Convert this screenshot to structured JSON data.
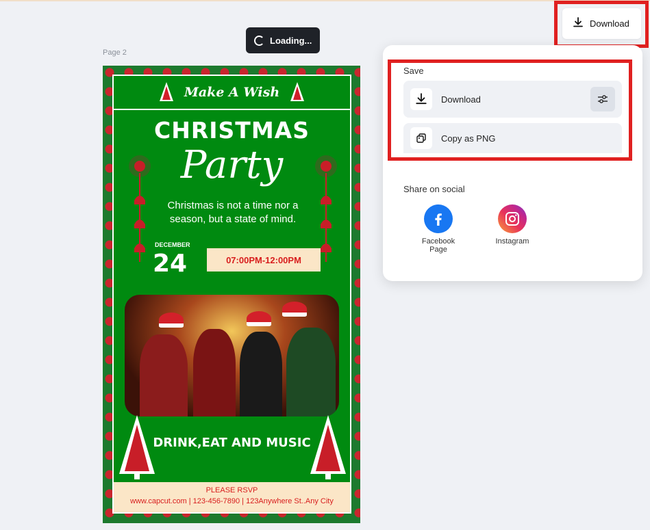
{
  "loading_text": "Loading...",
  "page_label": "Page 2",
  "topbar": {
    "download_label": "Download"
  },
  "panel": {
    "save_label": "Save",
    "download_label": "Download",
    "copy_label": "Copy as PNG",
    "share_label": "Share on social",
    "socials": [
      {
        "label": "Facebook Page",
        "icon": "facebook-icon"
      },
      {
        "label": "Instagram",
        "icon": "instagram-icon"
      }
    ]
  },
  "poster": {
    "header": "Make A Wish",
    "title_line1": "CHRISTMAS",
    "title_line2": "Party",
    "tagline": "Christmas is not a time nor a season, but a state of mind.",
    "month": "DECEMBER",
    "day": "24",
    "time": "07:00PM-12:00PM",
    "cta": "DRINK,EAT AND MUSIC",
    "rsvp_title": "PLEASE RSVP",
    "rsvp_line": "www.capcut.com | 123-456-7890 | 123Anywhere St..Any City"
  },
  "colors": {
    "accent_red": "#e02020",
    "poster_green": "#008a10",
    "facebook": "#1877f2"
  }
}
